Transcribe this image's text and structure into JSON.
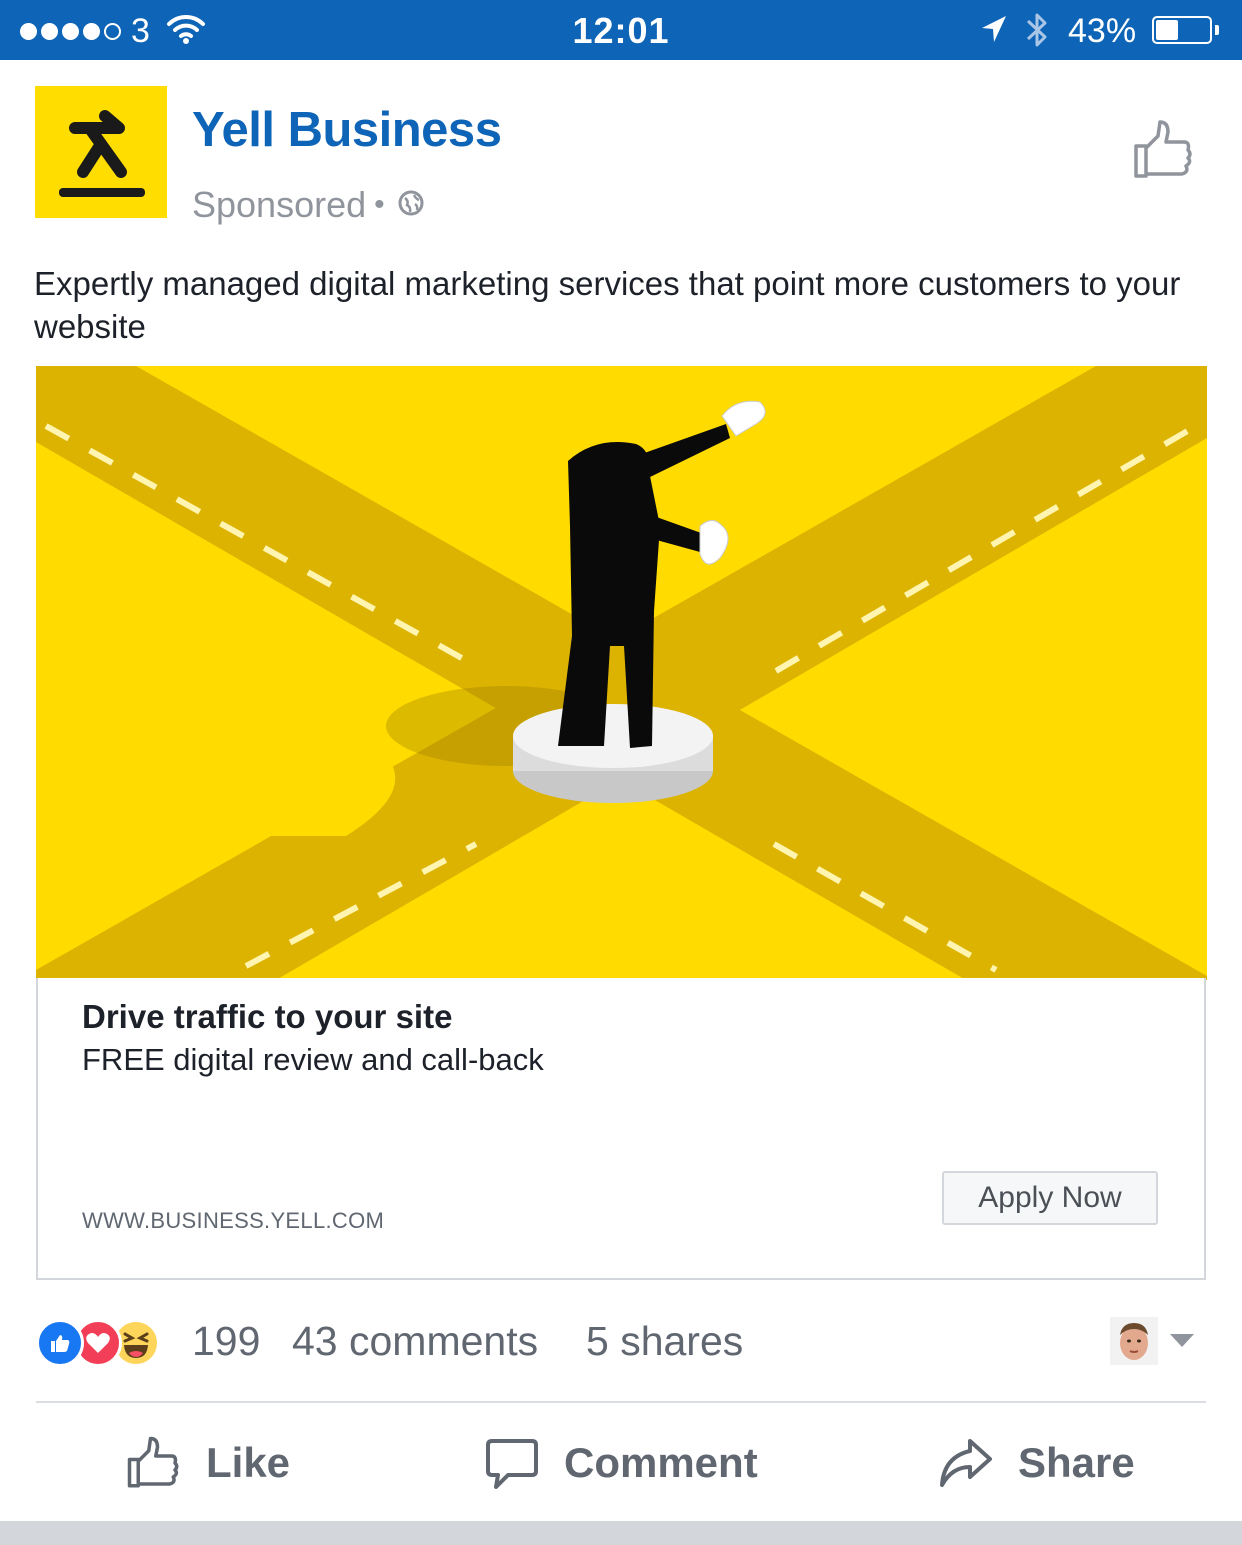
{
  "status_bar": {
    "carrier": "3",
    "time": "12:01",
    "battery_percent": "43%",
    "battery_level": 0.43,
    "signal_bars": 4,
    "signal_total": 5,
    "background_color": "#0e64b6"
  },
  "post": {
    "page_name": "Yell Business",
    "sponsored_label": "Sponsored",
    "separator": "•",
    "audience_icon": "globe-icon",
    "message": "Expertly managed digital marketing services that point more customers to your website"
  },
  "ad": {
    "headline": "Drive traffic to your site",
    "description": "FREE digital review and call-back",
    "domain": "WWW.BUSINESS.YELL.COM",
    "cta_label": "Apply Now",
    "brand_color": "#ffdd00"
  },
  "engagement": {
    "reaction_icons": [
      "like-reaction-icon",
      "love-reaction-icon",
      "haha-reaction-icon"
    ],
    "reaction_count": "199",
    "comments": "43 comments",
    "shares": "5 shares"
  },
  "actions": {
    "like_label": "Like",
    "comment_label": "Comment",
    "share_label": "Share"
  }
}
